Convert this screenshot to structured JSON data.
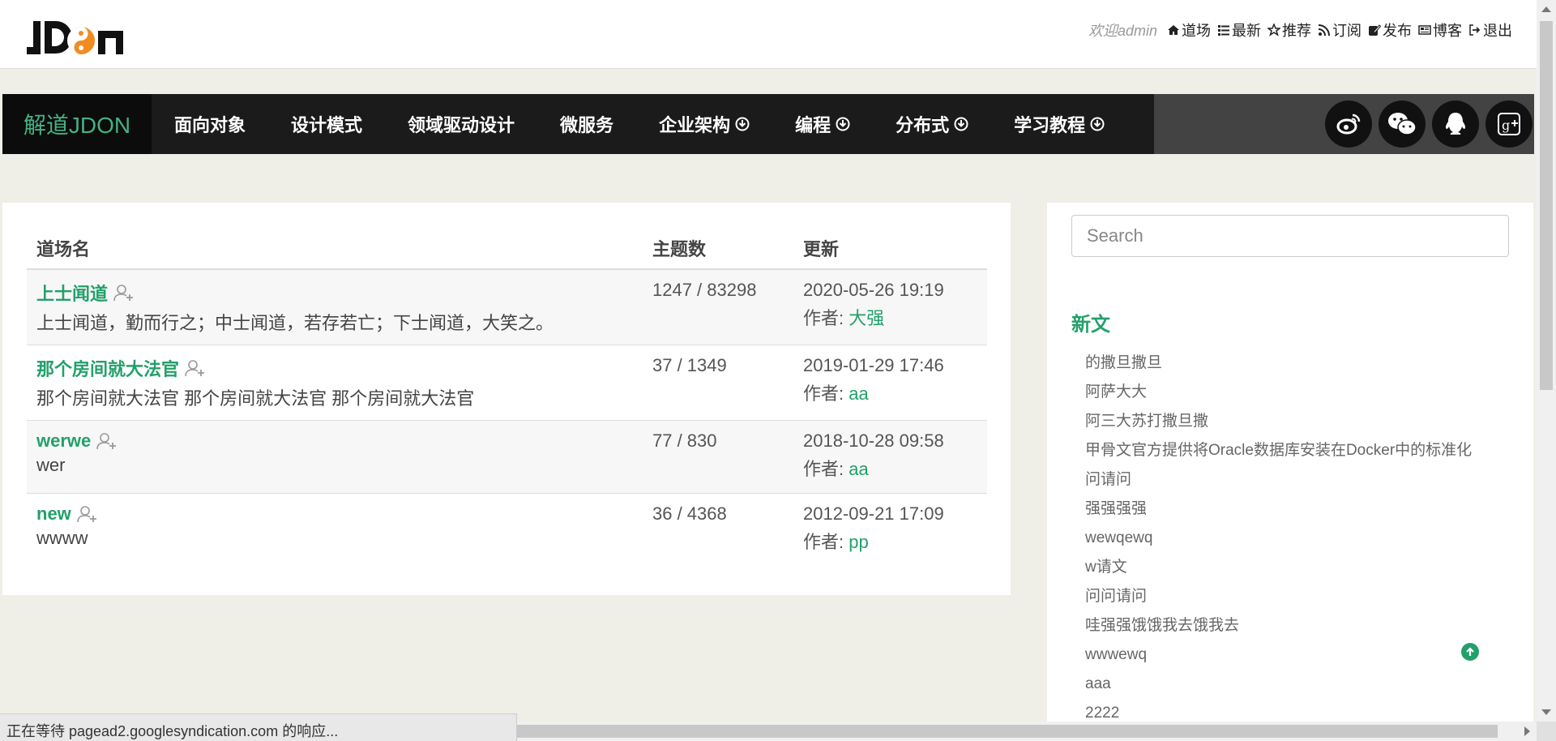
{
  "colors": {
    "accent": "#23a06a",
    "nav_bg": "#1b1b1b",
    "page_bg": "#efefe8"
  },
  "header": {
    "welcome": "欢迎admin",
    "links": [
      {
        "label": "道场",
        "icon": "home-icon"
      },
      {
        "label": "最新",
        "icon": "list-icon"
      },
      {
        "label": "推荐",
        "icon": "star-icon"
      },
      {
        "label": "订阅",
        "icon": "rss-icon"
      },
      {
        "label": "发布",
        "icon": "edit-icon"
      },
      {
        "label": "博客",
        "icon": "newspaper-icon"
      },
      {
        "label": "退出",
        "icon": "logout-icon"
      }
    ]
  },
  "navbar": {
    "brand": "解道JDON",
    "items": [
      {
        "label": "面向对象",
        "dropdown": false
      },
      {
        "label": "设计模式",
        "dropdown": false
      },
      {
        "label": "领域驱动设计",
        "dropdown": false
      },
      {
        "label": "微服务",
        "dropdown": false
      },
      {
        "label": "企业架构",
        "dropdown": true
      },
      {
        "label": "编程",
        "dropdown": true
      },
      {
        "label": "分布式",
        "dropdown": true
      },
      {
        "label": "学习教程",
        "dropdown": true
      }
    ],
    "social": [
      "weibo-icon",
      "wechat-icon",
      "qq-icon",
      "google-plus-icon"
    ]
  },
  "table": {
    "headers": [
      "道场名",
      "主题数",
      "更新"
    ],
    "author_prefix": "作者: ",
    "rows": [
      {
        "title": "上士闻道",
        "desc": "上士闻道，勤而行之；中士闻道，若存若亡；下士闻道，大笑之。",
        "counts": "1247 / 83298",
        "date": "2020-05-26 19:19",
        "author": "大强"
      },
      {
        "title": "那个房间就大法官",
        "desc": "那个房间就大法官 那个房间就大法官 那个房间就大法官",
        "counts": "37 / 1349",
        "date": "2019-01-29 17:46",
        "author": "aa"
      },
      {
        "title": "werwe",
        "desc": "wer",
        "counts": "77 / 830",
        "date": "2018-10-28 09:58",
        "author": "aa"
      },
      {
        "title": "new",
        "desc": "wwww",
        "counts": "36 / 4368",
        "date": "2012-09-21 17:09",
        "author": "pp"
      }
    ]
  },
  "sidebar": {
    "search_placeholder": "Search",
    "heading": "新文",
    "items": [
      "的撒旦撒旦",
      "阿萨大大",
      "阿三大苏打撒旦撒",
      "甲骨文官方提供将Oracle数据库安装在Docker中的标准化",
      "问请问",
      "强强强强",
      "wewqewq",
      "w请文",
      "问问请问",
      "哇强强饿饿我去饿我去",
      "wwwewq",
      "aaa",
      "2222"
    ]
  },
  "status": "正在等待 pagead2.googlesyndication.com 的响应..."
}
